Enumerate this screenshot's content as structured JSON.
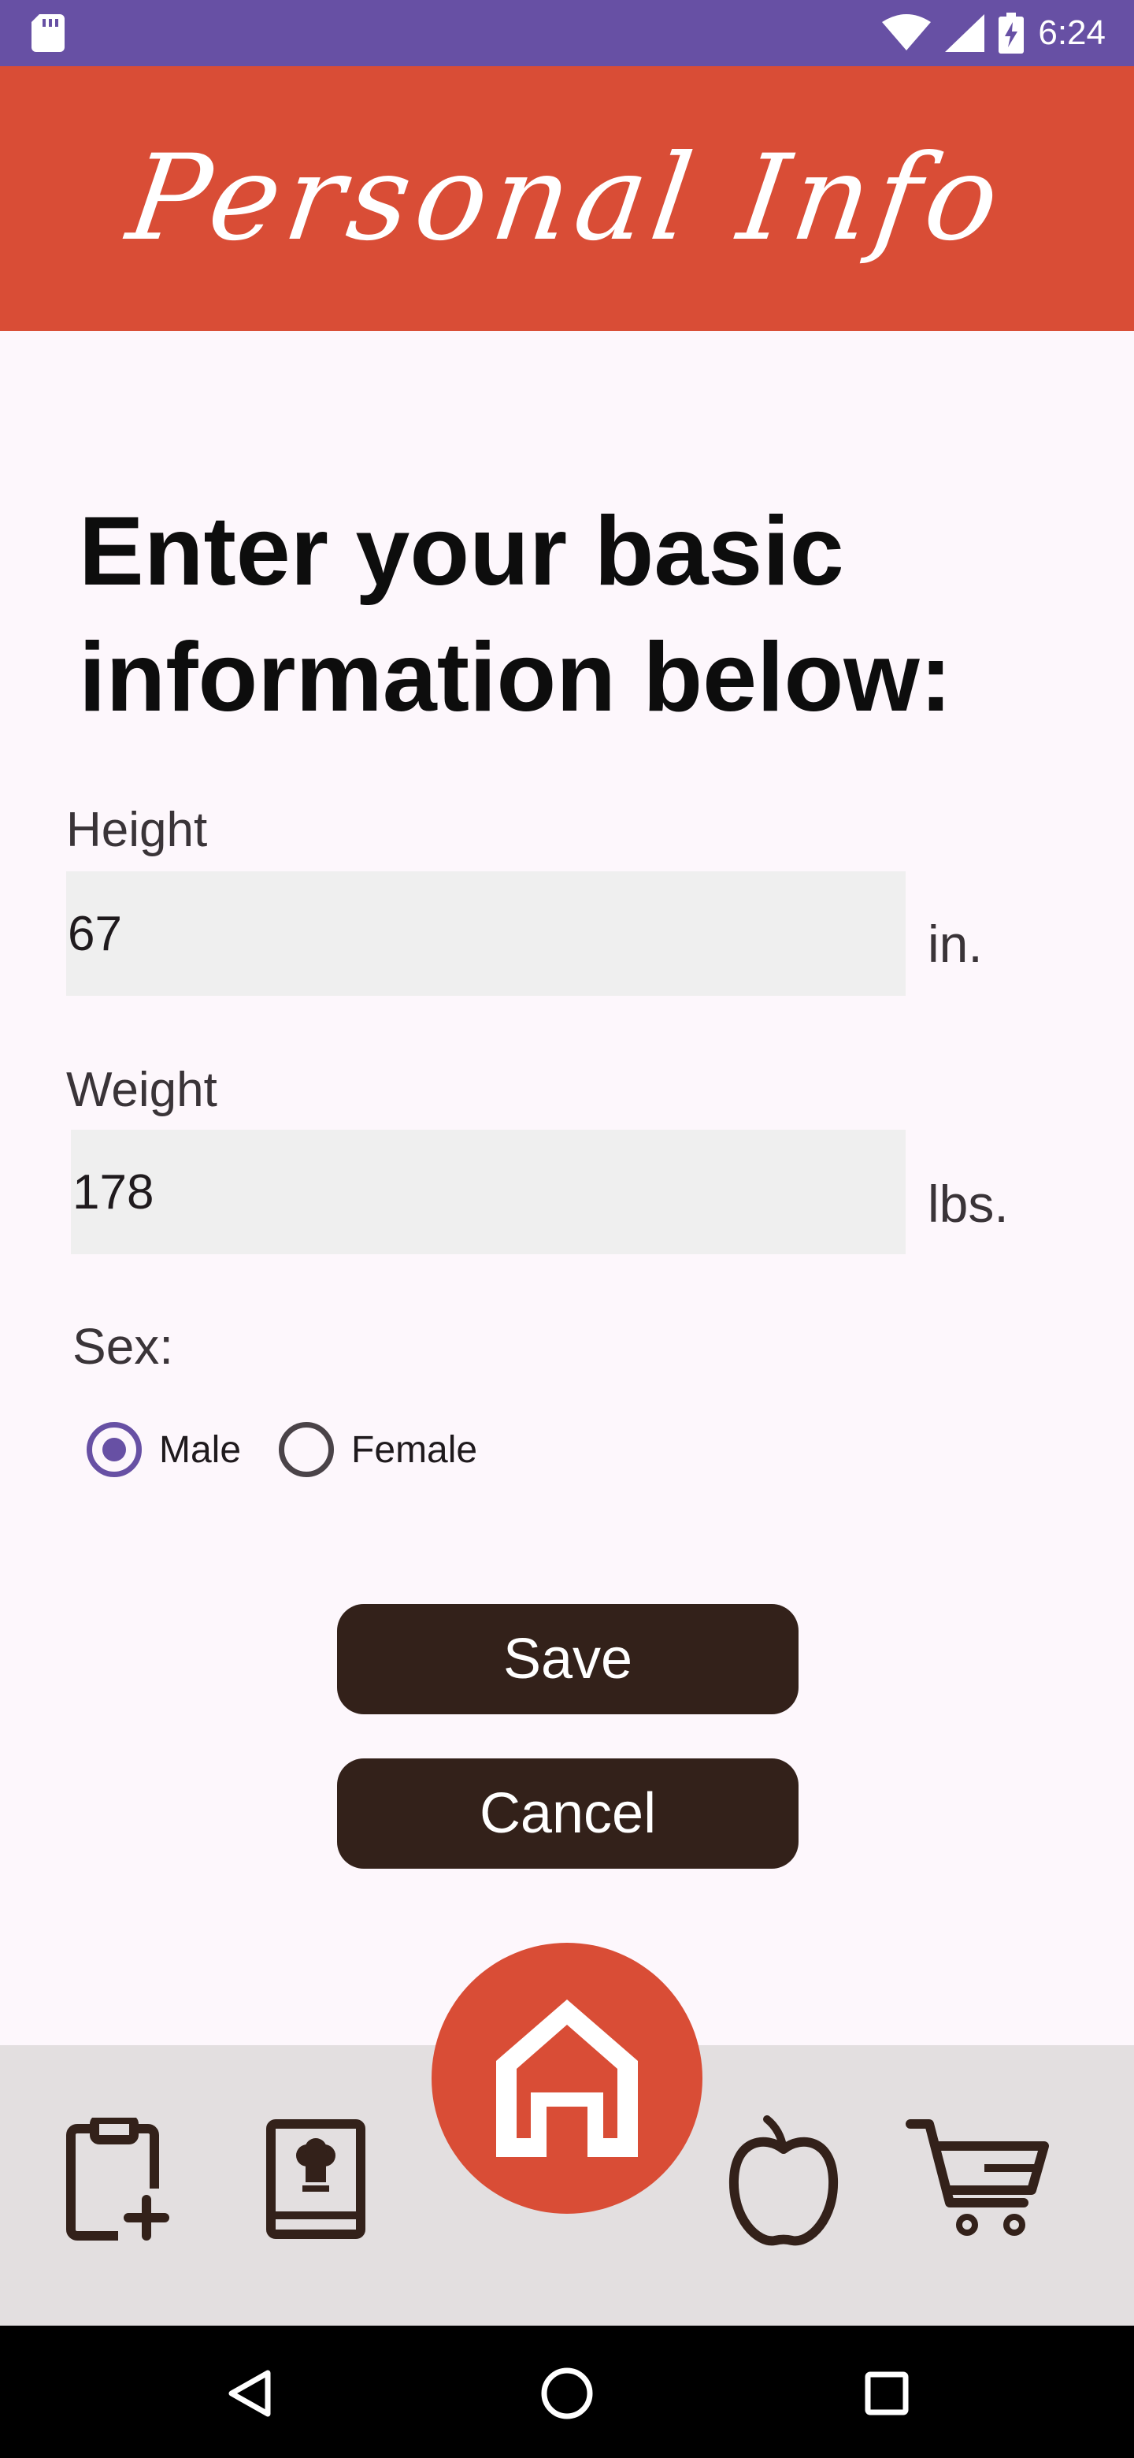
{
  "status_bar": {
    "time": "6:24"
  },
  "app_bar": {
    "title": "Personal Info"
  },
  "form": {
    "heading": "Enter your basic information below:",
    "height": {
      "label": "Height",
      "value": "67",
      "unit": "in."
    },
    "weight": {
      "label": "Weight",
      "value": "178",
      "unit": "lbs."
    },
    "sex": {
      "label": "Sex:",
      "options": [
        {
          "label": "Male",
          "selected": true
        },
        {
          "label": "Female",
          "selected": false
        }
      ]
    },
    "save_label": "Save",
    "cancel_label": "Cancel"
  },
  "bottom_nav": {
    "items": [
      {
        "icon": "clipboard-add-icon"
      },
      {
        "icon": "recipe-book-icon"
      },
      {
        "icon": "home-icon"
      },
      {
        "icon": "apple-icon"
      },
      {
        "icon": "shopping-cart-icon"
      }
    ]
  },
  "colors": {
    "status_bar": "#6750a4",
    "app_bar": "#d94d36",
    "button": "#33211a",
    "nav_background": "#e3dfe0",
    "radio_accent": "#6750a4"
  }
}
